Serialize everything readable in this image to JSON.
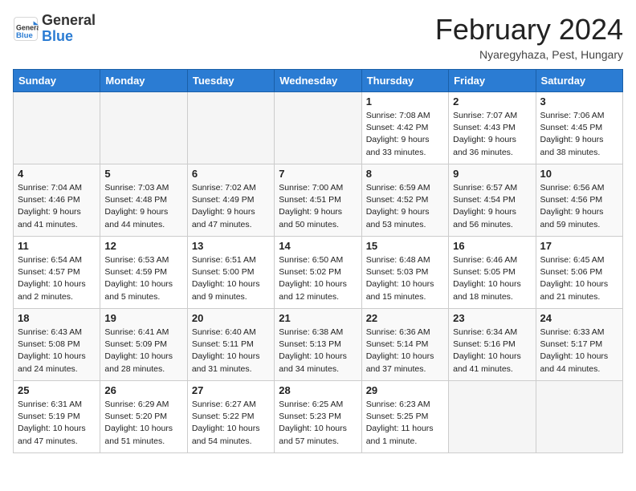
{
  "header": {
    "logo_line1": "General",
    "logo_line2": "Blue",
    "month_title": "February 2024",
    "location": "Nyaregyhaza, Pest, Hungary"
  },
  "days_of_week": [
    "Sunday",
    "Monday",
    "Tuesday",
    "Wednesday",
    "Thursday",
    "Friday",
    "Saturday"
  ],
  "weeks": [
    [
      {
        "day": "",
        "info": ""
      },
      {
        "day": "",
        "info": ""
      },
      {
        "day": "",
        "info": ""
      },
      {
        "day": "",
        "info": ""
      },
      {
        "day": "1",
        "info": "Sunrise: 7:08 AM\nSunset: 4:42 PM\nDaylight: 9 hours\nand 33 minutes."
      },
      {
        "day": "2",
        "info": "Sunrise: 7:07 AM\nSunset: 4:43 PM\nDaylight: 9 hours\nand 36 minutes."
      },
      {
        "day": "3",
        "info": "Sunrise: 7:06 AM\nSunset: 4:45 PM\nDaylight: 9 hours\nand 38 minutes."
      }
    ],
    [
      {
        "day": "4",
        "info": "Sunrise: 7:04 AM\nSunset: 4:46 PM\nDaylight: 9 hours\nand 41 minutes."
      },
      {
        "day": "5",
        "info": "Sunrise: 7:03 AM\nSunset: 4:48 PM\nDaylight: 9 hours\nand 44 minutes."
      },
      {
        "day": "6",
        "info": "Sunrise: 7:02 AM\nSunset: 4:49 PM\nDaylight: 9 hours\nand 47 minutes."
      },
      {
        "day": "7",
        "info": "Sunrise: 7:00 AM\nSunset: 4:51 PM\nDaylight: 9 hours\nand 50 minutes."
      },
      {
        "day": "8",
        "info": "Sunrise: 6:59 AM\nSunset: 4:52 PM\nDaylight: 9 hours\nand 53 minutes."
      },
      {
        "day": "9",
        "info": "Sunrise: 6:57 AM\nSunset: 4:54 PM\nDaylight: 9 hours\nand 56 minutes."
      },
      {
        "day": "10",
        "info": "Sunrise: 6:56 AM\nSunset: 4:56 PM\nDaylight: 9 hours\nand 59 minutes."
      }
    ],
    [
      {
        "day": "11",
        "info": "Sunrise: 6:54 AM\nSunset: 4:57 PM\nDaylight: 10 hours\nand 2 minutes."
      },
      {
        "day": "12",
        "info": "Sunrise: 6:53 AM\nSunset: 4:59 PM\nDaylight: 10 hours\nand 5 minutes."
      },
      {
        "day": "13",
        "info": "Sunrise: 6:51 AM\nSunset: 5:00 PM\nDaylight: 10 hours\nand 9 minutes."
      },
      {
        "day": "14",
        "info": "Sunrise: 6:50 AM\nSunset: 5:02 PM\nDaylight: 10 hours\nand 12 minutes."
      },
      {
        "day": "15",
        "info": "Sunrise: 6:48 AM\nSunset: 5:03 PM\nDaylight: 10 hours\nand 15 minutes."
      },
      {
        "day": "16",
        "info": "Sunrise: 6:46 AM\nSunset: 5:05 PM\nDaylight: 10 hours\nand 18 minutes."
      },
      {
        "day": "17",
        "info": "Sunrise: 6:45 AM\nSunset: 5:06 PM\nDaylight: 10 hours\nand 21 minutes."
      }
    ],
    [
      {
        "day": "18",
        "info": "Sunrise: 6:43 AM\nSunset: 5:08 PM\nDaylight: 10 hours\nand 24 minutes."
      },
      {
        "day": "19",
        "info": "Sunrise: 6:41 AM\nSunset: 5:09 PM\nDaylight: 10 hours\nand 28 minutes."
      },
      {
        "day": "20",
        "info": "Sunrise: 6:40 AM\nSunset: 5:11 PM\nDaylight: 10 hours\nand 31 minutes."
      },
      {
        "day": "21",
        "info": "Sunrise: 6:38 AM\nSunset: 5:13 PM\nDaylight: 10 hours\nand 34 minutes."
      },
      {
        "day": "22",
        "info": "Sunrise: 6:36 AM\nSunset: 5:14 PM\nDaylight: 10 hours\nand 37 minutes."
      },
      {
        "day": "23",
        "info": "Sunrise: 6:34 AM\nSunset: 5:16 PM\nDaylight: 10 hours\nand 41 minutes."
      },
      {
        "day": "24",
        "info": "Sunrise: 6:33 AM\nSunset: 5:17 PM\nDaylight: 10 hours\nand 44 minutes."
      }
    ],
    [
      {
        "day": "25",
        "info": "Sunrise: 6:31 AM\nSunset: 5:19 PM\nDaylight: 10 hours\nand 47 minutes."
      },
      {
        "day": "26",
        "info": "Sunrise: 6:29 AM\nSunset: 5:20 PM\nDaylight: 10 hours\nand 51 minutes."
      },
      {
        "day": "27",
        "info": "Sunrise: 6:27 AM\nSunset: 5:22 PM\nDaylight: 10 hours\nand 54 minutes."
      },
      {
        "day": "28",
        "info": "Sunrise: 6:25 AM\nSunset: 5:23 PM\nDaylight: 10 hours\nand 57 minutes."
      },
      {
        "day": "29",
        "info": "Sunrise: 6:23 AM\nSunset: 5:25 PM\nDaylight: 11 hours\nand 1 minute."
      },
      {
        "day": "",
        "info": ""
      },
      {
        "day": "",
        "info": ""
      }
    ]
  ]
}
